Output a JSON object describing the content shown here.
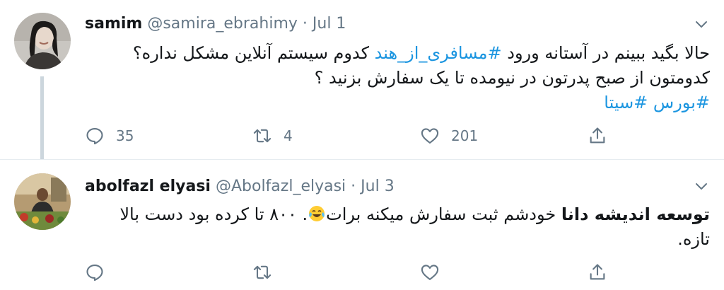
{
  "tweets": [
    {
      "name": "samim",
      "handle": "@samira_ebrahimy",
      "separator": "·",
      "date": "Jul 1",
      "line1_pre": "حالا بگید ببینم در آستانه ورود ",
      "line1_tag": "#مسافری_از_هند",
      "line1_post": " کدوم سیستم آنلاین مشکل نداره؟",
      "line2": "کدومتون از صبح پدرتون در نیومده تا یک سفارش بزنید ؟",
      "line3_tag1": "#بورس",
      "line3_tag2": "#سیتا",
      "reply_count": "35",
      "retweet_count": "4",
      "like_count": "201"
    },
    {
      "name": "abolfazl elyasi",
      "handle": "@Abolfazl_elyasi",
      "separator": "·",
      "date": "Jul 3",
      "line1_bold": "توسعه اندیشه دانا",
      "line1_rest": " خودشم ثبت سفارش میکنه برات",
      "line1_end": ". ۸۰۰ تا کرده بود دست بالا",
      "line2": "تازه."
    }
  ],
  "icons": [
    "reply-icon",
    "retweet-icon",
    "like-icon",
    "share-icon",
    "chevron-down-icon",
    "tears-of-joy-emoji"
  ],
  "colors": {
    "link": "#1b95e0",
    "muted": "#657786",
    "divider": "#e6ecf0",
    "thread": "#ccd6dd"
  }
}
